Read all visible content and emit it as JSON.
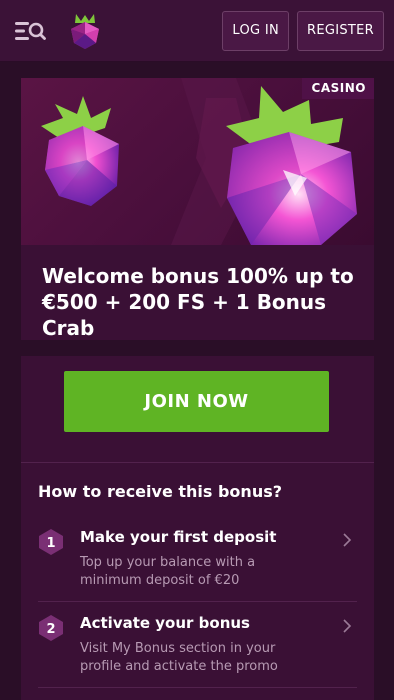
{
  "header": {
    "login_label": "LOG IN",
    "register_label": "REGISTER",
    "menu_icon": "menu-search-icon",
    "logo_icon": "raspberry-logo-icon"
  },
  "promo": {
    "badge": "CASINO",
    "title": "Welcome bonus 100% up to €500 + 200 FS + 1 Bonus Crab"
  },
  "bonus": {
    "join_label": "JOIN NOW",
    "how_title": "How to receive this bonus?",
    "steps": [
      {
        "num": "1",
        "title": "Make your first deposit",
        "desc": "Top up your balance with a minimum deposit of €20"
      },
      {
        "num": "2",
        "title": "Activate your bonus",
        "desc": "Visit My Bonus section in your profile and activate the promo"
      }
    ]
  },
  "colors": {
    "accent_green": "#5fb424",
    "bg": "#2a0e27",
    "card": "#3a1035"
  }
}
